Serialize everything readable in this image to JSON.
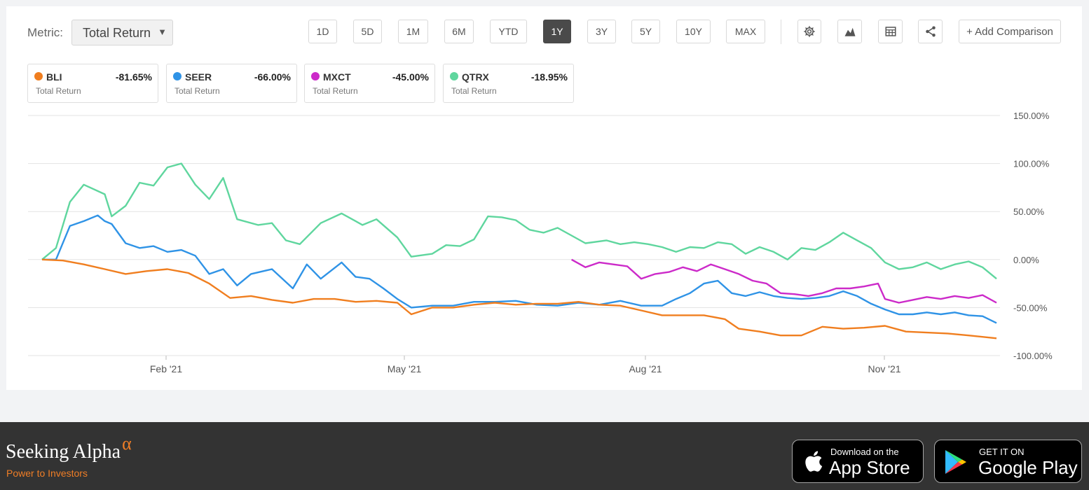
{
  "metric": {
    "label": "Metric:",
    "value": "Total Return"
  },
  "periods": [
    "1D",
    "5D",
    "1M",
    "6M",
    "YTD",
    "1Y",
    "3Y",
    "5Y",
    "10Y",
    "MAX"
  ],
  "active_period": "1Y",
  "add_comparison": "+ Add Comparison",
  "toolbar_icons": [
    "gear-icon",
    "chart-type-icon",
    "table-icon",
    "share-icon"
  ],
  "tickers": [
    {
      "symbol": "BLI",
      "change": "-81.65%",
      "label": "Total Return",
      "color": "#f07e1f"
    },
    {
      "symbol": "SEER",
      "change": "-66.00%",
      "label": "Total Return",
      "color": "#2f93e6"
    },
    {
      "symbol": "MXCT",
      "change": "-45.00%",
      "label": "Total Return",
      "color": "#cc2ac9"
    },
    {
      "symbol": "QTRX",
      "change": "-18.95%",
      "label": "Total Return",
      "color": "#5fd69e"
    }
  ],
  "chart_data": {
    "type": "line",
    "y_ticks": [
      "150.00%",
      "100.00%",
      "50.00%",
      "0.00%",
      "-50.00%",
      "-100.00%"
    ],
    "x_ticks": [
      "Feb '21",
      "May '21",
      "Aug '21",
      "Nov '21"
    ],
    "ylim": [
      -100,
      150
    ],
    "grid": true,
    "series": [
      {
        "name": "QTRX",
        "color": "#5fd69e",
        "points": [
          [
            0,
            0
          ],
          [
            2,
            12
          ],
          [
            4,
            60
          ],
          [
            6,
            78
          ],
          [
            9,
            68
          ],
          [
            10,
            45
          ],
          [
            12,
            56
          ],
          [
            14,
            80
          ],
          [
            16,
            77
          ],
          [
            18,
            96
          ],
          [
            20,
            100
          ],
          [
            22,
            78
          ],
          [
            24,
            63
          ],
          [
            26,
            85
          ],
          [
            28,
            42
          ],
          [
            31,
            36
          ],
          [
            33,
            38
          ],
          [
            35,
            20
          ],
          [
            37,
            16
          ],
          [
            40,
            38
          ],
          [
            43,
            48
          ],
          [
            46,
            36
          ],
          [
            48,
            42
          ],
          [
            51,
            23
          ],
          [
            53,
            3
          ],
          [
            56,
            6
          ],
          [
            58,
            15
          ],
          [
            60,
            14
          ],
          [
            62,
            21
          ],
          [
            64,
            45
          ],
          [
            66,
            44
          ],
          [
            68,
            41
          ],
          [
            70,
            31
          ],
          [
            72,
            28
          ],
          [
            74,
            33
          ],
          [
            76,
            25
          ],
          [
            78,
            17
          ],
          [
            81,
            20
          ],
          [
            83,
            16
          ],
          [
            85,
            18
          ],
          [
            87,
            16
          ],
          [
            89,
            13
          ],
          [
            91,
            8
          ],
          [
            93,
            13
          ],
          [
            95,
            12
          ],
          [
            97,
            18
          ],
          [
            99,
            16
          ],
          [
            101,
            6
          ],
          [
            103,
            13
          ],
          [
            105,
            8
          ],
          [
            107,
            0
          ],
          [
            109,
            12
          ],
          [
            111,
            10
          ],
          [
            113,
            18
          ],
          [
            115,
            28
          ],
          [
            117,
            20
          ],
          [
            119,
            12
          ],
          [
            121,
            -3
          ],
          [
            123,
            -10
          ],
          [
            125,
            -8
          ],
          [
            127,
            -3
          ],
          [
            129,
            -10
          ],
          [
            131,
            -5
          ],
          [
            133,
            -2
          ],
          [
            135,
            -8
          ],
          [
            137,
            -20
          ]
        ]
      },
      {
        "name": "SEER",
        "color": "#2f93e6",
        "points": [
          [
            0,
            0
          ],
          [
            2,
            0
          ],
          [
            4,
            35
          ],
          [
            6,
            40
          ],
          [
            8,
            46
          ],
          [
            9,
            40
          ],
          [
            10,
            37
          ],
          [
            12,
            17
          ],
          [
            14,
            12
          ],
          [
            16,
            14
          ],
          [
            18,
            8
          ],
          [
            20,
            10
          ],
          [
            22,
            4
          ],
          [
            24,
            -15
          ],
          [
            26,
            -10
          ],
          [
            28,
            -27
          ],
          [
            30,
            -15
          ],
          [
            33,
            -10
          ],
          [
            36,
            -30
          ],
          [
            38,
            -5
          ],
          [
            40,
            -20
          ],
          [
            43,
            -3
          ],
          [
            45,
            -18
          ],
          [
            47,
            -20
          ],
          [
            49,
            -30
          ],
          [
            51,
            -41
          ],
          [
            53,
            -50
          ],
          [
            56,
            -48
          ],
          [
            59,
            -48
          ],
          [
            62,
            -44
          ],
          [
            65,
            -44
          ],
          [
            68,
            -43
          ],
          [
            71,
            -47
          ],
          [
            74,
            -48
          ],
          [
            77,
            -45
          ],
          [
            80,
            -47
          ],
          [
            83,
            -43
          ],
          [
            86,
            -48
          ],
          [
            89,
            -48
          ],
          [
            91,
            -41
          ],
          [
            93,
            -35
          ],
          [
            95,
            -25
          ],
          [
            97,
            -22
          ],
          [
            99,
            -35
          ],
          [
            101,
            -38
          ],
          [
            103,
            -34
          ],
          [
            105,
            -38
          ],
          [
            107,
            -40
          ],
          [
            109,
            -41
          ],
          [
            111,
            -40
          ],
          [
            113,
            -38
          ],
          [
            115,
            -33
          ],
          [
            117,
            -38
          ],
          [
            119,
            -46
          ],
          [
            121,
            -52
          ],
          [
            123,
            -57
          ],
          [
            125,
            -57
          ],
          [
            127,
            -55
          ],
          [
            129,
            -57
          ],
          [
            131,
            -55
          ],
          [
            133,
            -58
          ],
          [
            135,
            -59
          ],
          [
            137,
            -66
          ]
        ]
      },
      {
        "name": "MXCT",
        "color": "#cc2ac9",
        "points": [
          [
            76,
            0
          ],
          [
            78,
            -8
          ],
          [
            80,
            -3
          ],
          [
            82,
            -5
          ],
          [
            84,
            -7
          ],
          [
            86,
            -20
          ],
          [
            88,
            -15
          ],
          [
            90,
            -13
          ],
          [
            92,
            -8
          ],
          [
            94,
            -12
          ],
          [
            96,
            -5
          ],
          [
            98,
            -10
          ],
          [
            100,
            -15
          ],
          [
            102,
            -22
          ],
          [
            104,
            -25
          ],
          [
            106,
            -35
          ],
          [
            108,
            -36
          ],
          [
            110,
            -38
          ],
          [
            112,
            -35
          ],
          [
            114,
            -30
          ],
          [
            116,
            -30
          ],
          [
            118,
            -28
          ],
          [
            120,
            -25
          ],
          [
            121,
            -41
          ],
          [
            123,
            -45
          ],
          [
            125,
            -42
          ],
          [
            127,
            -39
          ],
          [
            129,
            -41
          ],
          [
            131,
            -38
          ],
          [
            133,
            -40
          ],
          [
            135,
            -37
          ],
          [
            137,
            -45
          ]
        ]
      },
      {
        "name": "BLI",
        "color": "#f07e1f",
        "points": [
          [
            0,
            0
          ],
          [
            3,
            -1
          ],
          [
            6,
            -5
          ],
          [
            9,
            -10
          ],
          [
            12,
            -15
          ],
          [
            15,
            -12
          ],
          [
            18,
            -10
          ],
          [
            21,
            -14
          ],
          [
            24,
            -25
          ],
          [
            27,
            -40
          ],
          [
            30,
            -38
          ],
          [
            33,
            -42
          ],
          [
            36,
            -45
          ],
          [
            39,
            -41
          ],
          [
            42,
            -41
          ],
          [
            45,
            -44
          ],
          [
            48,
            -43
          ],
          [
            51,
            -45
          ],
          [
            53,
            -57
          ],
          [
            56,
            -50
          ],
          [
            59,
            -50
          ],
          [
            62,
            -47
          ],
          [
            65,
            -45
          ],
          [
            68,
            -47
          ],
          [
            71,
            -46
          ],
          [
            74,
            -46
          ],
          [
            77,
            -44
          ],
          [
            80,
            -47
          ],
          [
            83,
            -48
          ],
          [
            86,
            -53
          ],
          [
            89,
            -58
          ],
          [
            92,
            -58
          ],
          [
            95,
            -58
          ],
          [
            98,
            -62
          ],
          [
            100,
            -72
          ],
          [
            103,
            -75
          ],
          [
            106,
            -79
          ],
          [
            109,
            -79
          ],
          [
            112,
            -70
          ],
          [
            115,
            -72
          ],
          [
            118,
            -71
          ],
          [
            121,
            -69
          ],
          [
            124,
            -75
          ],
          [
            127,
            -76
          ],
          [
            130,
            -77
          ],
          [
            133,
            -79
          ],
          [
            137,
            -82
          ]
        ]
      }
    ]
  },
  "footer": {
    "brand": "Seeking Alpha",
    "alpha": "α",
    "tagline": "Power to Investors",
    "app_store_small": "Download on the",
    "app_store_big": "App Store",
    "google_small": "GET IT ON",
    "google_big": "Google Play"
  }
}
